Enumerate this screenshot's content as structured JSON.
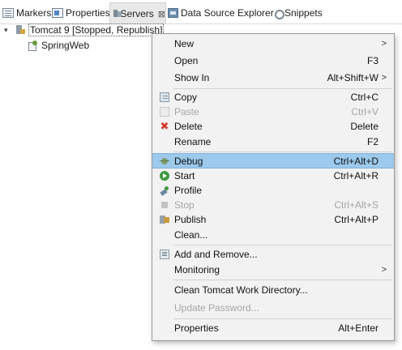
{
  "tabs": [
    {
      "label": "Markers",
      "icon": "markers-icon"
    },
    {
      "label": "Properties",
      "icon": "properties-icon"
    },
    {
      "label": "Servers",
      "icon": "servers-icon",
      "active": true,
      "close": "⊠"
    },
    {
      "label": "Data Source Explorer",
      "icon": "data-source-explorer-icon"
    },
    {
      "label": "Snippets",
      "icon": "snippets-icon"
    }
  ],
  "tree": {
    "server": {
      "twisty": "▾",
      "label": "Tomcat 9  [Stopped, Republish]"
    },
    "module": {
      "label": "SpringWeb"
    }
  },
  "menu": {
    "items": [
      {
        "label": "New",
        "accel": "",
        "submenu": ">"
      },
      {
        "label": "Open",
        "accel": "F3"
      },
      {
        "label": "Show In",
        "accel": "Alt+Shift+W",
        "submenu": ">"
      },
      {
        "label": "Copy",
        "accel": "Ctrl+C",
        "icon": "copy-icon"
      },
      {
        "label": "Paste",
        "accel": "Ctrl+V",
        "icon": "paste-icon",
        "disabled": true
      },
      {
        "label": "Delete",
        "accel": "Delete",
        "icon": "delete-icon",
        "icon_glyph": "✖"
      },
      {
        "label": "Rename",
        "accel": "F2"
      },
      {
        "label": "Debug",
        "accel": "Ctrl+Alt+D",
        "icon": "debug-icon",
        "highlighted": true
      },
      {
        "label": "Start",
        "accel": "Ctrl+Alt+R",
        "icon": "start-icon"
      },
      {
        "label": "Profile",
        "accel": "",
        "icon": "profile-icon"
      },
      {
        "label": "Stop",
        "accel": "Ctrl+Alt+S",
        "icon": "stop-icon",
        "disabled": true
      },
      {
        "label": "Publish",
        "accel": "Ctrl+Alt+P",
        "icon": "publish-icon"
      },
      {
        "label": "Clean...",
        "accel": ""
      },
      {
        "label": "Add and Remove...",
        "accel": "",
        "icon": "add-remove-icon"
      },
      {
        "label": "Monitoring",
        "accel": "",
        "submenu": ">"
      },
      {
        "label": "Clean Tomcat Work Directory...",
        "accel": ""
      },
      {
        "label": "Update Password...",
        "accel": "",
        "disabled": true
      },
      {
        "label": "Properties",
        "accel": "Alt+Enter"
      }
    ]
  },
  "colors": {
    "menu_background": "#f2f2f2",
    "highlight": "#9cc9ec",
    "disabled_text": "#a6a6a6",
    "delete_icon": "#d23b2e",
    "start_icon": "#3f9a3f"
  }
}
